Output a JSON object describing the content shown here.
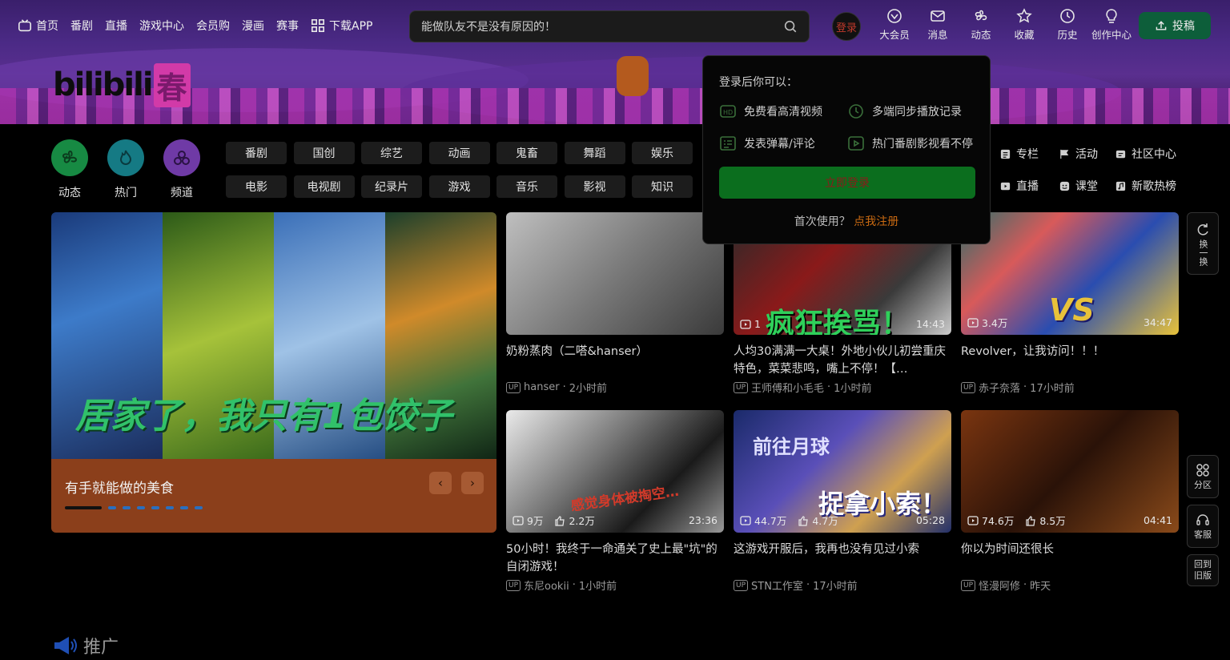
{
  "nav": {
    "items": [
      "首页",
      "番剧",
      "直播",
      "游戏中心",
      "会员购",
      "漫画",
      "赛事",
      "下载APP"
    ]
  },
  "search": {
    "text": "能做队友不是没有原因的！"
  },
  "login_avatar": "登录",
  "right_icons": [
    "大会员",
    "消息",
    "动态",
    "收藏",
    "历史",
    "创作中心"
  ],
  "post_button": "投稿",
  "logo": {
    "bili": "bilibili",
    "spring": "春"
  },
  "channels": [
    "动态",
    "热门",
    "频道"
  ],
  "categories": [
    "番剧",
    "国创",
    "综艺",
    "动画",
    "鬼畜",
    "舞蹈",
    "娱乐",
    "电影",
    "电视剧",
    "纪录片",
    "游戏",
    "音乐",
    "影视",
    "知识"
  ],
  "categories_right": [
    "专栏",
    "活动",
    "社区中心",
    "直播",
    "课堂",
    "新歌热榜"
  ],
  "carousel": {
    "overlay_title": "居家了，我只有1包饺子",
    "caption": "有手就能做的美食",
    "prev": "‹",
    "next": "›"
  },
  "cards": [
    {
      "title": "奶粉蒸肉（二嗒&hanser）",
      "author": "hanser",
      "time": "2小时前",
      "views": "",
      "likes": "",
      "duration": "",
      "overlay": ""
    },
    {
      "title": "人均30满满一大桌！外地小伙儿初尝重庆特色，菜菜悲鸣，嘴上不停！【…",
      "author": "王师傅和小毛毛",
      "time": "1小时前",
      "views": "1",
      "likes": "",
      "duration": "14:43",
      "overlay": "疯狂挨骂！"
    },
    {
      "title": "Revolver，让我访问！！！",
      "author": "赤子奈落",
      "time": "17小时前",
      "views": "3.4万",
      "likes": "",
      "duration": "34:47",
      "overlay": "VS"
    },
    {
      "title": "50小时！我终于一命通关了史上最\"坑\"的自闭游戏！",
      "author": "东尼ookii",
      "time": "1小时前",
      "views": "9万",
      "likes": "2.2万",
      "duration": "23:36",
      "overlay": "感觉身体被掏空…"
    },
    {
      "title": "这游戏开服后，我再也没有见过小索",
      "author": "STN工作室",
      "time": "17小时前",
      "views": "44.7万",
      "likes": "4.7万",
      "duration": "05:28",
      "overlay": "捉拿小索！"
    },
    {
      "title": "你以为时间还很长",
      "author": "怪漫阿修",
      "time": "昨天",
      "views": "74.6万",
      "likes": "8.5万",
      "duration": "04:41",
      "overlay": ""
    }
  ],
  "card_extra": {
    "moon": "前往月球"
  },
  "side": {
    "refresh": "换一换",
    "zone": "分区",
    "service": "客服",
    "old": "回到旧版"
  },
  "promo": "推广",
  "popup": {
    "title": "登录后你可以：",
    "features": [
      "免费看高清视频",
      "多端同步播放记录",
      "发表弹幕/评论",
      "热门番剧影视看不停"
    ],
    "login_button": "立即登录",
    "register_prompt": "首次使用？",
    "register_link": "点我注册"
  },
  "colors": {
    "accent": "#0b6e1e",
    "link": "#c96a12",
    "banner": "#4b2a86"
  }
}
